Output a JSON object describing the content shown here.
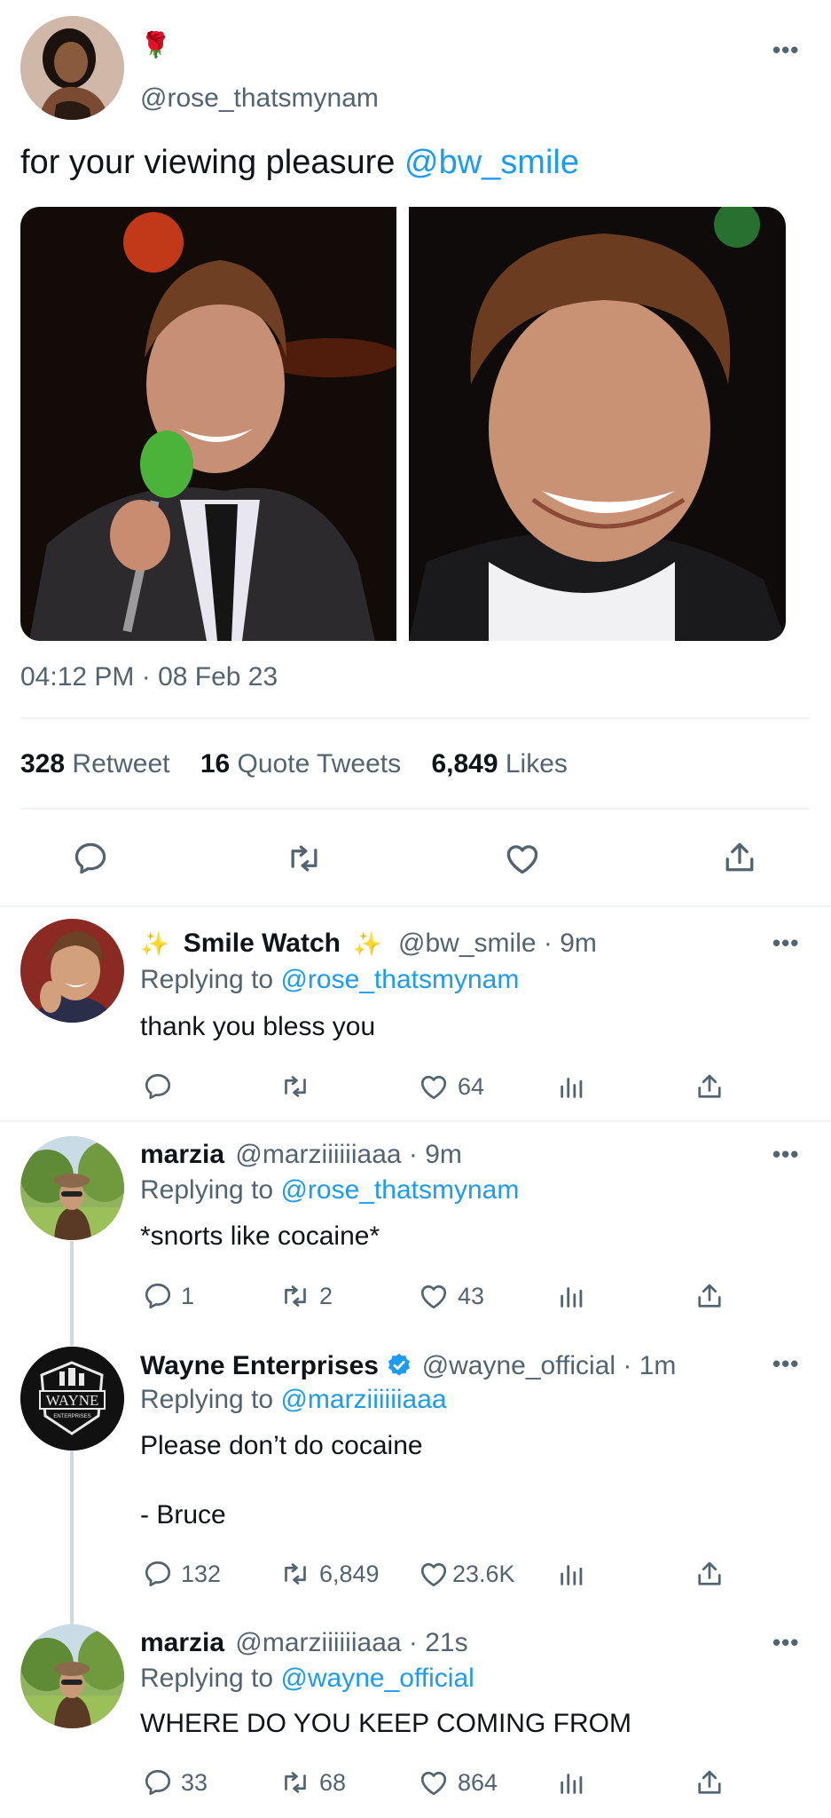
{
  "main_tweet": {
    "display_name_emoji": "🌹",
    "handle": "@rose_thatsmynam",
    "text": "for your viewing pleasure ",
    "mention": "@bw_smile",
    "timestamp": "04:12 PM · 08 Feb 23",
    "stats": {
      "retweets_count": "328",
      "retweets_label": "Retweet",
      "quotes_count": "16",
      "quotes_label": "Quote Tweets",
      "likes_count": "6,849",
      "likes_label": "Likes"
    }
  },
  "replies": [
    {
      "name": "Smile Watch",
      "name_prefix": "✨",
      "name_suffix": "✨",
      "handle": "@bw_smile",
      "time": " · 9m",
      "replying_label": "Replying to ",
      "replying_to": "@rose_thatsmynam",
      "text": "thank you bless you",
      "replies": "",
      "retweets": "",
      "likes": "64"
    },
    {
      "name": "marzia",
      "handle": "@marziiiiiiaaa",
      "time": " · 9m",
      "replying_label": "Replying to ",
      "replying_to": "@rose_thatsmynam",
      "text": "*snorts like cocaine*",
      "replies": "1",
      "retweets": "2",
      "likes": "43"
    },
    {
      "name": "Wayne Enterprises",
      "handle": "@wayne_official",
      "time": " · 1m",
      "replying_label": "Replying to ",
      "replying_to": "@marziiiiiiaaa",
      "text": "Please don’t do cocaine",
      "text2": "- Bruce",
      "avatar_text": "WAYNE",
      "avatar_subtext": "ENTERPRISES",
      "replies": "132",
      "retweets": "6,849",
      "likes": "23.6K"
    },
    {
      "name": "marzia",
      "handle": "@marziiiiiiaaa",
      "time": " · 21s",
      "replying_label": "Replying to ",
      "replying_to": "@wayne_official",
      "text": "WHERE DO YOU KEEP COMING FROM",
      "replies": "33",
      "retweets": "68",
      "likes": "864"
    }
  ],
  "more_glyph": "•••",
  "colors": {
    "accent": "#1d9bf0",
    "secondary_text": "#536471",
    "verified": "#1d9bf0"
  }
}
